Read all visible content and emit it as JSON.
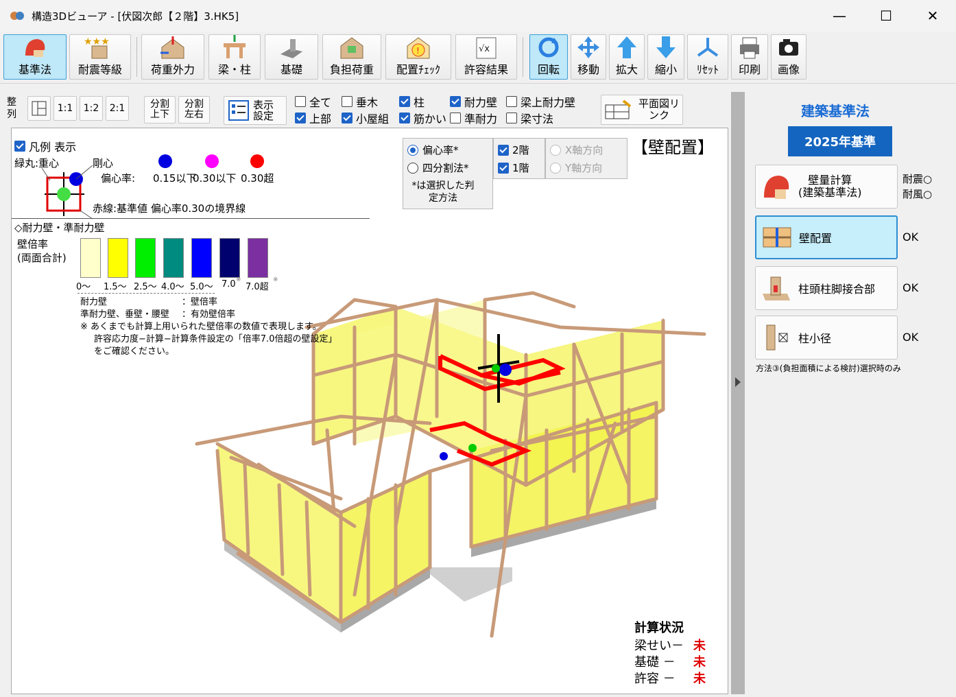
{
  "window": {
    "title": "構造3Dビューア - [伏図次郎【２階】3.HK5]",
    "minimize": "—",
    "maximize": "☐",
    "close": "✕"
  },
  "toolbar": {
    "kijunho": "基準法",
    "taishin": "耐震等級",
    "kaju": "荷重外力",
    "hari": "梁・柱",
    "kiso": "基礎",
    "futan": "負担荷重",
    "haichi": "配置ﾁｪｯｸ",
    "kyoyo": "許容結果",
    "kaiten": "回転",
    "ido": "移動",
    "kakudai": "拡大",
    "shukusho": "縮小",
    "reset": "ﾘｾｯﾄ",
    "insatsu": "印刷",
    "gazo": "画像"
  },
  "subbar": {
    "seiretsu": "整列",
    "r11": "1:1",
    "r12": "1:2",
    "r21": "2:1",
    "split_ud": "分割上下",
    "split_lr": "分割左右",
    "display_settings": "表示設定",
    "plan_link": "平面図リンク",
    "checks": {
      "all": {
        "label": "全て",
        "on": false
      },
      "taruki": {
        "label": "垂木",
        "on": false
      },
      "hashira": {
        "label": "柱",
        "on": true
      },
      "tairyokuheki": {
        "label": "耐力壁",
        "on": true
      },
      "hariue": {
        "label": "梁上耐力壁",
        "on": false
      },
      "jobu": {
        "label": "上部",
        "on": true
      },
      "koyagumi": {
        "label": "小屋組",
        "on": true
      },
      "sujikai": {
        "label": "筋かい",
        "on": true
      },
      "juntairyoku": {
        "label": "準耐力",
        "on": false
      },
      "hari_sunpo": {
        "label": "梁寸法",
        "on": false
      }
    }
  },
  "viewport": {
    "mode_label": "【壁配置】",
    "legend_show": "凡例 表示",
    "green_circle": "緑丸:重心",
    "rigid_center": "剛心",
    "eccentricity": "偏心率:",
    "ecc_levels": [
      "0.15以下",
      "0.30以下",
      "0.30超"
    ],
    "ecc_colors": [
      "#0000e0",
      "#ff00ff",
      "#ff0000"
    ],
    "red_line": "赤線:基準値 偏心率0.30の境界線",
    "wall_heading": "◇耐力壁・準耐力壁",
    "wall_ratio_label_1": "壁倍率",
    "wall_ratio_label_2": "(両面合計)",
    "swatches": [
      {
        "color": "#ffffcc",
        "label": "0～"
      },
      {
        "color": "#ffff00",
        "label": "1.5～"
      },
      {
        "color": "#00ee00",
        "label": "2.5～"
      },
      {
        "color": "#008b80",
        "label": "4.0～"
      },
      {
        "color": "#0000ff",
        "label": "5.0～"
      },
      {
        "color": "#00006e",
        "label": "7.0"
      },
      {
        "color": "#7b2fa0",
        "label": "7.0超"
      }
    ],
    "swatch_mark": "※",
    "note_1a": "耐力壁",
    "note_1b": "：壁倍率",
    "note_2a": "準耐力壁、垂壁・腰壁",
    "note_2b": "：有効壁倍率",
    "note_3": "※ あくまでも計算上用いられた壁倍率の数値で表現します。",
    "note_4": "許容応力度−計算−計算条件設定の「倍率7.0倍超の壁設定」",
    "note_5": "をご確認ください。",
    "method": {
      "henshin": "偏心率*",
      "yonbun": "四分割法*",
      "note": "*は選択した判定方法",
      "floor2": "2階",
      "floor1": "1階",
      "x_dir": "X軸方向",
      "y_dir": "Y軸方向"
    },
    "calc_title": "計算状況",
    "calc_rows": [
      {
        "label": "梁せい－",
        "status": "未"
      },
      {
        "label": "基礎 －",
        "status": "未"
      },
      {
        "label": "許容 －",
        "status": "未"
      }
    ]
  },
  "rpanel": {
    "title": "建築基準法",
    "standard": "2025年基準",
    "items": [
      {
        "label": "壁量計算\n(建築基準法)",
        "status": ""
      },
      {
        "label": "壁配置",
        "status": "OK"
      },
      {
        "label": "柱頭柱脚接合部",
        "status": "OK"
      },
      {
        "label": "柱小径",
        "status": "OK"
      }
    ],
    "side_1": "耐震○",
    "side_2": "耐風○",
    "note": "方法③(負担面積による検討)選択時のみ"
  }
}
